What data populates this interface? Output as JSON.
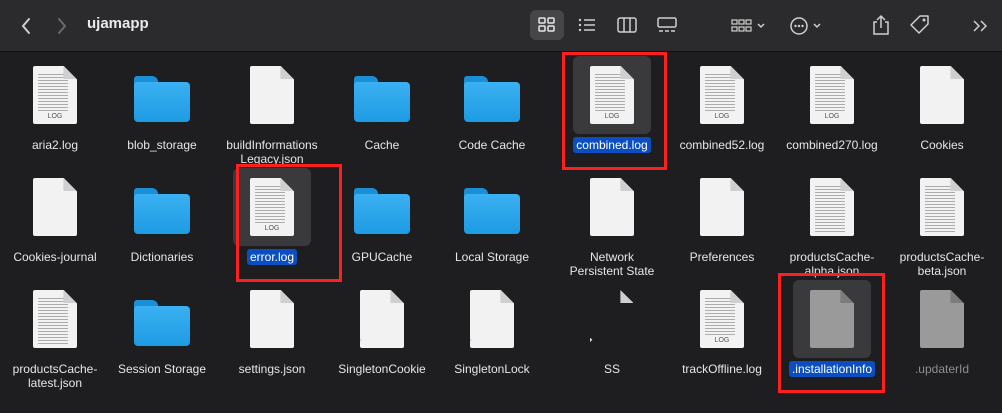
{
  "window": {
    "title": "ujamapp"
  },
  "toolbar": {
    "back_icon": "chevron-left-icon",
    "forward_icon": "chevron-right-icon",
    "views": [
      "grid-view-icon",
      "list-view-icon",
      "column-view-icon",
      "gallery-view-icon"
    ],
    "active_view": 0
  },
  "items": [
    {
      "label": "aria2.log",
      "kind": "log"
    },
    {
      "label": "blob_storage",
      "kind": "folder"
    },
    {
      "label": "buildInformationsLegacy.json",
      "label_lines": [
        "buildInformations",
        "Legacy.json"
      ],
      "kind": "doc"
    },
    {
      "label": "Cache",
      "kind": "folder"
    },
    {
      "label": "Code Cache",
      "kind": "folder"
    },
    {
      "label": "combined.log",
      "kind": "log",
      "selected": true
    },
    {
      "label": "combined52.log",
      "kind": "log"
    },
    {
      "label": "combined270.log",
      "kind": "log"
    },
    {
      "label": "Cookies",
      "kind": "doc"
    },
    {
      "label": "Cookies-journal",
      "kind": "doc"
    },
    {
      "label": "Dictionaries",
      "kind": "folder"
    },
    {
      "label": "error.log",
      "kind": "log",
      "selected": true
    },
    {
      "label": "GPUCache",
      "kind": "folder"
    },
    {
      "label": "Local Storage",
      "kind": "folder"
    },
    {
      "label": "Network Persistent State",
      "label_lines": [
        "Network",
        "Persistent State"
      ],
      "kind": "doc"
    },
    {
      "label": "Preferences",
      "kind": "doc"
    },
    {
      "label": "productsCache-alpha.json",
      "label_lines": [
        "productsCache-",
        "alpha.json"
      ],
      "kind": "dense"
    },
    {
      "label": "productsCache-beta.json",
      "label_lines": [
        "productsCache-",
        "beta.json"
      ],
      "kind": "dense"
    },
    {
      "label": "productsCache-latest.json",
      "label_lines": [
        "productsCache-",
        "latest.json"
      ],
      "kind": "dense"
    },
    {
      "label": "Session Storage",
      "kind": "folder"
    },
    {
      "label": "settings.json",
      "kind": "doc"
    },
    {
      "label": "SingletonCookie",
      "kind": "alias"
    },
    {
      "label": "SingletonLock",
      "kind": "alias"
    },
    {
      "label": "SS",
      "kind": "alias-blank"
    },
    {
      "label": "trackOffline.log",
      "kind": "log"
    },
    {
      "label": ".installationInfo",
      "kind": "hidden",
      "selected": true
    },
    {
      "label": ".updaterId",
      "kind": "hidden"
    }
  ],
  "log_tag": "LOG",
  "colors": {
    "selection": "#0a4ec2",
    "folder": "#1d9be3",
    "annotation": "#ff1f1f"
  }
}
